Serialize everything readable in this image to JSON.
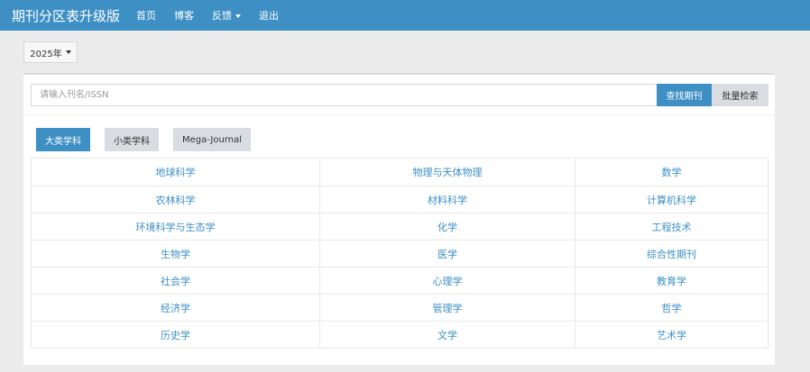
{
  "navbar": {
    "brand": "期刊分区表升级版",
    "links": [
      "首页",
      "博客",
      "反馈",
      "退出"
    ]
  },
  "year_selector": {
    "label": "2025年"
  },
  "search": {
    "placeholder": "请输入刊名/ISSN",
    "value": "",
    "search_button": "查找期刊",
    "batch_button": "批量检索"
  },
  "tabs": [
    {
      "label": "大类学科",
      "active": true
    },
    {
      "label": "小类学科",
      "active": false
    },
    {
      "label": "Mega-Journal",
      "active": false
    }
  ],
  "subjects": [
    [
      "地球科学",
      "物理与天体物理",
      "数学"
    ],
    [
      "农林科学",
      "材料科学",
      "计算机科学"
    ],
    [
      "环境科学与生态学",
      "化学",
      "工程技术"
    ],
    [
      "生物学",
      "医学",
      "综合性期刊"
    ],
    [
      "社会学",
      "心理学",
      "教育学"
    ],
    [
      "经济学",
      "管理学",
      "哲学"
    ],
    [
      "历史学",
      "文学",
      "艺术学"
    ]
  ],
  "colors": {
    "primary": "#3d8fc4",
    "background": "#ececec",
    "inactive_tab": "#d9dde1"
  }
}
